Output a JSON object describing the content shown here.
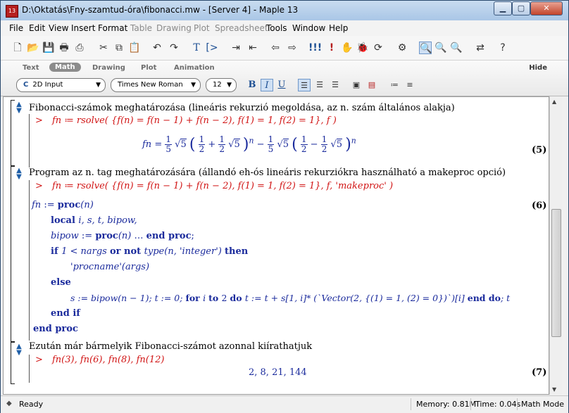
{
  "window": {
    "title": "D:\\Oktatás\\Fny-szamtud-óra\\fibonacci.mw - [Server 4] - Maple 13",
    "app_icon_text": "13"
  },
  "menu": [
    "File",
    "Edit",
    "View",
    "Insert",
    "Format",
    "Table",
    "Drawing",
    "Plot",
    "Spreadsheet",
    "Tools",
    "Window",
    "Help"
  ],
  "context_bar": {
    "modes": [
      "Text",
      "Math",
      "Drawing",
      "Plot",
      "Animation"
    ],
    "active_mode": "Math",
    "hide_label": "Hide",
    "input_mode": "2D Input",
    "font": "Times New Roman",
    "size": "12",
    "format_buttons": [
      "B",
      "I",
      "U"
    ]
  },
  "document": {
    "sec1": {
      "heading": "Fibonacci-számok meghatározása (lineáris rekurzió megoldása, az n. szám általános alakja)",
      "prompt": ">",
      "input": "fn ≔ rsolve( {f(n) = f(n − 1) + f(n − 2), f(1) = 1, f(2) = 1}, f )",
      "eq_label": "(5)"
    },
    "sec2": {
      "heading": "Program az n. tag meghatározására (állandó eh-ós lineáris rekurziókra használható a makeproc opció)",
      "prompt": ">",
      "input": "fn ≔ rsolve( {f(n) = f(n − 1) + f(n − 2), f(1) = 1, f(2) = 1}, f, 'makeproc' )",
      "eq_label": "(6)",
      "proc_lines": {
        "l1_name": "fn",
        "l1_assign": " := ",
        "l1_kw": "proc",
        "l1_arg": "(n)",
        "l2_kw": "local ",
        "l2_vars": "i, s, t, bipow,",
        "l3_var": "bipow",
        "l3_assign": " := ",
        "l3_kw": "proc",
        "l3_arg": "(n)",
        "l3_dots": " … ",
        "l3_end": "end proc",
        "l3_semicolon": ";",
        "l4_kw": "if ",
        "l4_cond1": "1 < nargs ",
        "l4_or": "or ",
        "l4_not": "not ",
        "l4_cond2": "type(n, 'integer') ",
        "l4_then": "then",
        "l5": "'procname'(args)",
        "l6": "else",
        "l7_a": "s := bipow(n − 1); t := 0; ",
        "l7_for": "for ",
        "l7_i": "i ",
        "l7_to": "to ",
        "l7_2": "2 ",
        "l7_do": "do ",
        "l7_body": "t := t + s[1, i]* (`Vector(2, {(1) = 1, (2) = 0})`)[i] ",
        "l7_enddo": "end do",
        "l7_tail": "; t",
        "l8": "end if",
        "l9": "end proc"
      }
    },
    "sec3": {
      "heading": "Ezután már bármelyik Fibonacci-számot azonnal kiírathatjuk",
      "prompt": ">",
      "input": "fn(3), fn(6), fn(8), fn(12)",
      "output": "2, 8, 21, 144",
      "eq_label": "(7)"
    },
    "formula": {
      "lhs": "fn",
      "eq": " = ",
      "one": "1",
      "five": "5",
      "half": "1",
      "two": "2",
      "sqrt": "√",
      "plus": " + ",
      "minus": " − ",
      "n": "n"
    }
  },
  "status": {
    "ready": "Ready",
    "memory": "Memory: 0.81M",
    "time": "Time: 0.04s",
    "mode": "Math Mode"
  }
}
